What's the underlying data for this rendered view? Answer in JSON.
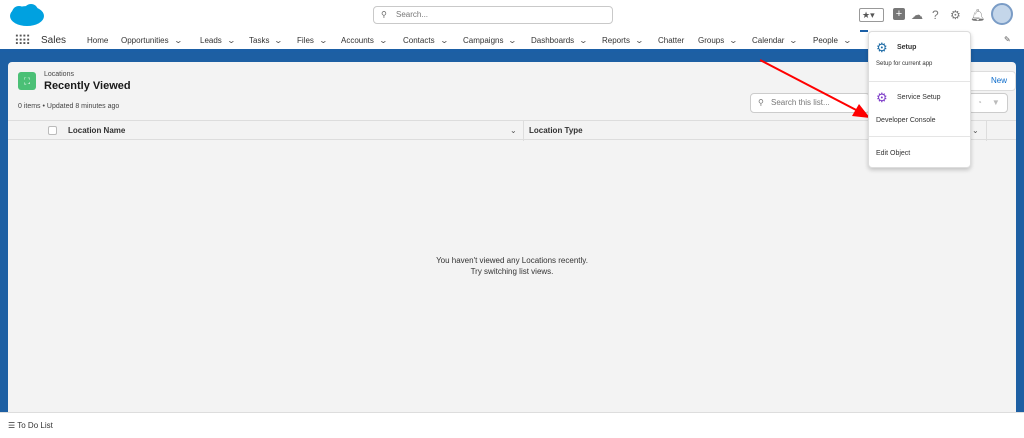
{
  "header": {
    "search_placeholder": "Search...",
    "icons": [
      "favorites-star-icon",
      "add-icon",
      "trailhead-icon",
      "help-icon",
      "setup-gear-icon",
      "notifications-bell-icon",
      "avatar"
    ]
  },
  "nav": {
    "app_name": "Sales",
    "items": [
      {
        "label": "Home",
        "dropdown": false
      },
      {
        "label": "Opportunities",
        "dropdown": true
      },
      {
        "label": "Leads",
        "dropdown": true
      },
      {
        "label": "Tasks",
        "dropdown": true
      },
      {
        "label": "Files",
        "dropdown": true
      },
      {
        "label": "Accounts",
        "dropdown": true
      },
      {
        "label": "Contacts",
        "dropdown": true
      },
      {
        "label": "Campaigns",
        "dropdown": true
      },
      {
        "label": "Dashboards",
        "dropdown": true
      },
      {
        "label": "Reports",
        "dropdown": true
      },
      {
        "label": "Chatter",
        "dropdown": false
      },
      {
        "label": "Groups",
        "dropdown": true
      },
      {
        "label": "Calendar",
        "dropdown": true
      },
      {
        "label": "People",
        "dropdown": true
      }
    ]
  },
  "list": {
    "object": "Locations",
    "view": "Recently Viewed",
    "status": "0 items • Updated 8 minutes ago",
    "new_label": "New",
    "search_placeholder": "Search this list...",
    "columns": [
      "Location Name",
      "Location Type"
    ],
    "empty_line1": "You haven't viewed any Locations recently.",
    "empty_line2": "Try switching list views."
  },
  "setup_menu": {
    "setup_label": "Setup",
    "setup_sub": "Setup for current app",
    "service_setup": "Service Setup",
    "developer_console": "Developer Console",
    "edit_object": "Edit Object"
  },
  "footer": {
    "todo": "To Do List"
  },
  "colors": {
    "brand": "#00a1e0",
    "nav_bar": "#1b5fa6",
    "object_icon": "#4bc076",
    "arrow": "#ff0000",
    "setup_icon": "#1b6aa5",
    "service_icon": "#7d3cc8"
  }
}
